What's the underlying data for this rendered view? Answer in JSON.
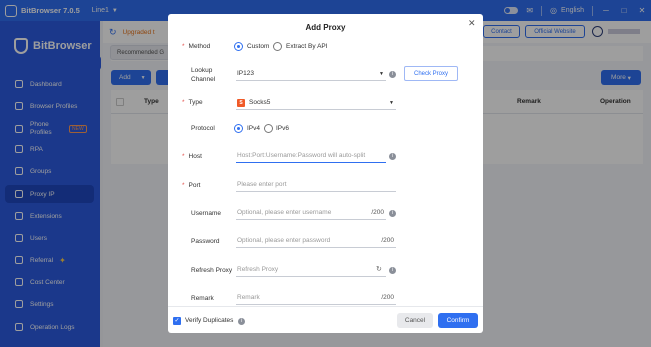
{
  "titlebar": {
    "app_title": "BitBrowser 7.0.5",
    "line": "Line1",
    "language": "English"
  },
  "sidebar": {
    "brand": "BitBrowser",
    "items": [
      {
        "label": "Dashboard",
        "icon": "home-icon"
      },
      {
        "label": "Browser Profiles",
        "icon": "grid-icon"
      },
      {
        "label": "Phone Profiles",
        "icon": "phone-icon",
        "badge": "NEW"
      },
      {
        "label": "RPA",
        "icon": "rpa-icon"
      },
      {
        "label": "Groups",
        "icon": "groups-icon"
      },
      {
        "label": "Proxy IP",
        "icon": "proxy-icon",
        "active": true
      },
      {
        "label": "Extensions",
        "icon": "extensions-icon"
      },
      {
        "label": "Users",
        "icon": "users-icon"
      },
      {
        "label": "Referral",
        "icon": "referral-icon"
      },
      {
        "label": "Cost Center",
        "icon": "cost-icon"
      },
      {
        "label": "Settings",
        "icon": "settings-icon"
      },
      {
        "label": "Operation Logs",
        "icon": "logs-icon"
      }
    ]
  },
  "main": {
    "upgraded_text": "Upgraded t",
    "contact_label": "Contact",
    "official_website_label": "Official Website",
    "recommended_tab": "Recommended G",
    "add_label": "Add",
    "more_label": "More",
    "table_headers": {
      "type": "Type",
      "remark": "Remark",
      "operation": "Operation"
    }
  },
  "modal": {
    "title": "Add Proxy",
    "method_label": "Method",
    "method_options": [
      "Custom",
      "Extract By API"
    ],
    "method_selected": "Custom",
    "lookup_label_line1": "Lookup",
    "lookup_label_line2": "Channel",
    "lookup_value": "IP123",
    "check_proxy_label": "Check Proxy",
    "type_label": "Type",
    "type_value": "Socks5",
    "protocol_label": "Protocol",
    "protocol_options": [
      "IPv4",
      "IPv6"
    ],
    "protocol_selected": "IPv4",
    "host_label": "Host",
    "host_placeholder": "Host:Port:Username:Password will auto-split",
    "port_label": "Port",
    "port_placeholder": "Please enter port",
    "username_label": "Username",
    "username_placeholder": "Optional, please enter username",
    "username_count": "/200",
    "password_label": "Password",
    "password_placeholder": "Optional, please enter password",
    "password_count": "/200",
    "refresh_label": "Refresh Proxy",
    "refresh_placeholder": "Refresh Proxy",
    "remark_label": "Remark",
    "remark_placeholder": "Remark",
    "remark_count": "/200",
    "verify_label": "Verify Duplicates",
    "verify_checked": true,
    "cancel_label": "Cancel",
    "confirm_label": "Confirm"
  },
  "colors": {
    "accent": "#2f6ff0",
    "sidebar": "#2c5be0",
    "required": "#e4534e",
    "socks": "#f05a28"
  }
}
